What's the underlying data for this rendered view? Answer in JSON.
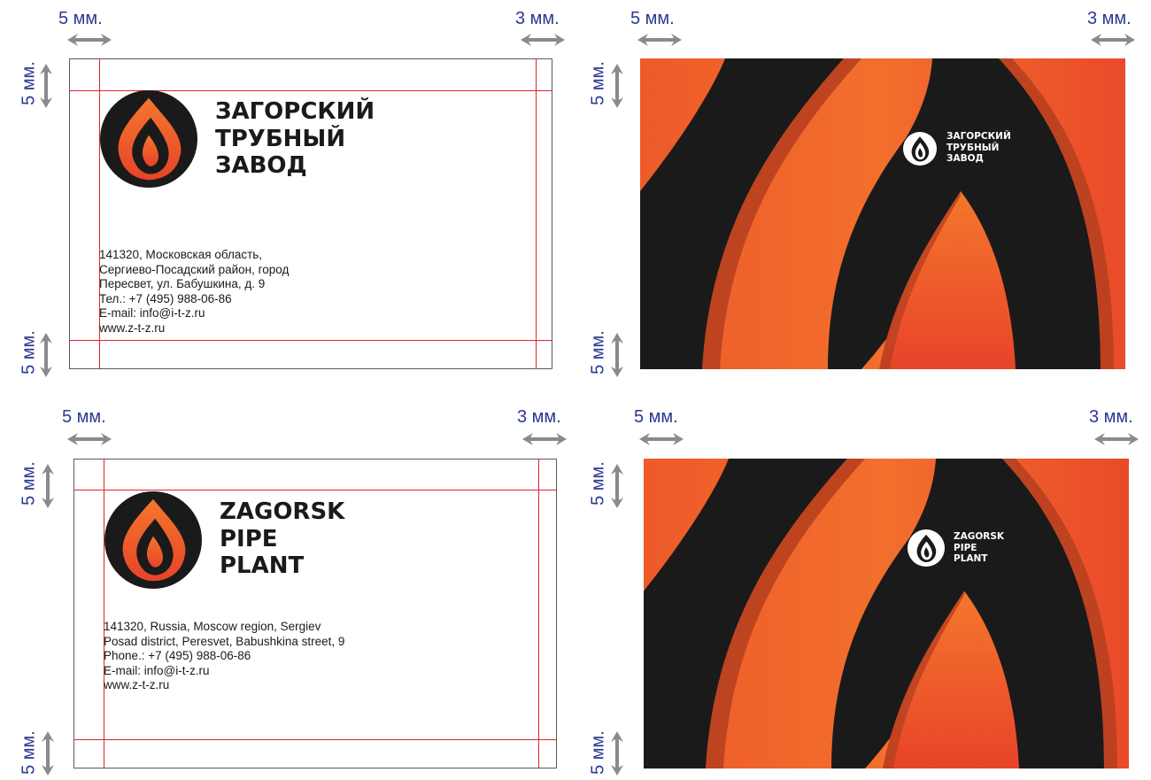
{
  "dimensions": {
    "left_margin": "5 мм.",
    "right_margin": "3 мм.",
    "top_margin": "5 мм.",
    "bottom_margin": "5 мм."
  },
  "cards_ru": {
    "front": {
      "company_lines": [
        "ЗАГОРСКИЙ",
        "ТРУБНЫЙ",
        "ЗАВОД"
      ],
      "address_lines": [
        "141320, Московская область,",
        "Сергиево-Посадский район, город",
        "Пересвет, ул. Бабушкина, д. 9",
        "Тел.: +7 (495) 988-06-86",
        "E-mail: info@i-t-z.ru",
        "www.z-t-z.ru"
      ]
    },
    "back": {
      "company_lines": [
        "ЗАГОРСКИЙ",
        "ТРУБНЫЙ",
        "ЗАВОД"
      ]
    }
  },
  "cards_en": {
    "front": {
      "company_lines": [
        "ZAGORSK",
        "PIPE",
        "PLANT"
      ],
      "address_lines": [
        "141320, Russia, Moscow region, Sergiev",
        "Posad district, Peresvet, Babushkina street, 9",
        "Phone.: +7 (495) 988-06-86",
        "E-mail: info@i-t-z.ru",
        "www.z-t-z.ru"
      ]
    },
    "back": {
      "company_lines": [
        "ZAGORSK",
        "PIPE",
        "PLANT"
      ]
    }
  },
  "colors": {
    "dimension_text": "#2b3990",
    "guide_line": "#e0242b",
    "card_dark": "#1b1a1a",
    "flame_orange": "#f06a2c",
    "flame_red": "#e8432a",
    "arrow_gray": "#8a8a8a"
  },
  "icons": {
    "logo": "flame-in-circle-icon",
    "arrow_h": "double-arrow-horizontal-icon",
    "arrow_v": "double-arrow-vertical-icon"
  }
}
